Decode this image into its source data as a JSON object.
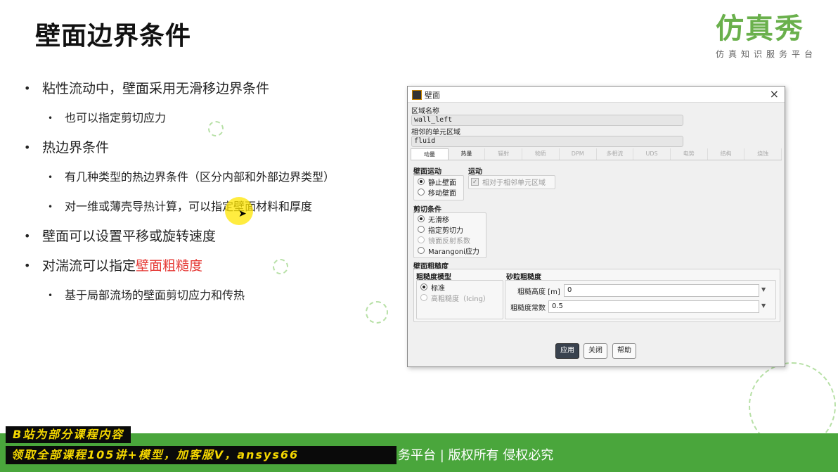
{
  "slide": {
    "title": "壁面边界条件",
    "logo_main": "仿真秀",
    "logo_sub": "仿真知识服务平台",
    "bullets": [
      {
        "level": 1,
        "text": "粘性流动中，壁面采用无滑移边界条件"
      },
      {
        "level": 2,
        "text": "也可以指定剪切应力"
      },
      {
        "level": 1,
        "text": "热边界条件"
      },
      {
        "level": 2,
        "text": "有几种类型的热边界条件（区分内部和外部边界类型）"
      },
      {
        "level": 2,
        "text": "对一维或薄壳导热计算，可以指定壁面材料和厚度"
      },
      {
        "level": 1,
        "text": "壁面可以设置平移或旋转速度"
      },
      {
        "level": 1,
        "text_prefix": "对湍流可以指定",
        "text_highlight": "壁面粗糙度"
      },
      {
        "level": 2,
        "text": "基于局部流场的壁面剪切应力和传热"
      }
    ],
    "highlight_color": "#e53935"
  },
  "dialog": {
    "title": "壁面",
    "zone_name_label": "区域名称",
    "zone_name_value": "wall_left",
    "adjacent_zone_label": "相邻的单元区域",
    "adjacent_zone_value": "fluid",
    "tabs": [
      "动量",
      "热量",
      "辐射",
      "物质",
      "DPM",
      "多相流",
      "UDS",
      "电势",
      "结构",
      "烧蚀"
    ],
    "wall_motion": {
      "label": "壁面运动",
      "options": [
        "静止壁面",
        "移动壁面"
      ],
      "selected": "静止壁面"
    },
    "motion": {
      "label": "运动",
      "checkbox_label": "相对于相邻单元区域",
      "checked": true
    },
    "shear": {
      "label": "剪切条件",
      "options": [
        "无滑移",
        "指定剪切力",
        "镜面反射系数",
        "Marangoni应力"
      ],
      "selected": "无滑移"
    },
    "roughness": {
      "label": "壁面粗糙度",
      "model_label": "粗糙度模型",
      "model_options": [
        "标准",
        "高粗糙度（Icing）"
      ],
      "model_selected": "标准",
      "sand_label": "砂粒粗糙度",
      "height_label": "粗糙高度 [m]",
      "height_value": "0",
      "constant_label": "粗糙度常数",
      "constant_value": "0.5"
    },
    "buttons": {
      "apply": "应用",
      "close": "关闭",
      "help": "帮助"
    }
  },
  "banner": {
    "text": "务平台 | 版权所有 侵权必究",
    "promo_line1": "B站为部分课程内容",
    "promo_line2": "领取全部课程105讲+模型，加客服V，ansys66"
  }
}
